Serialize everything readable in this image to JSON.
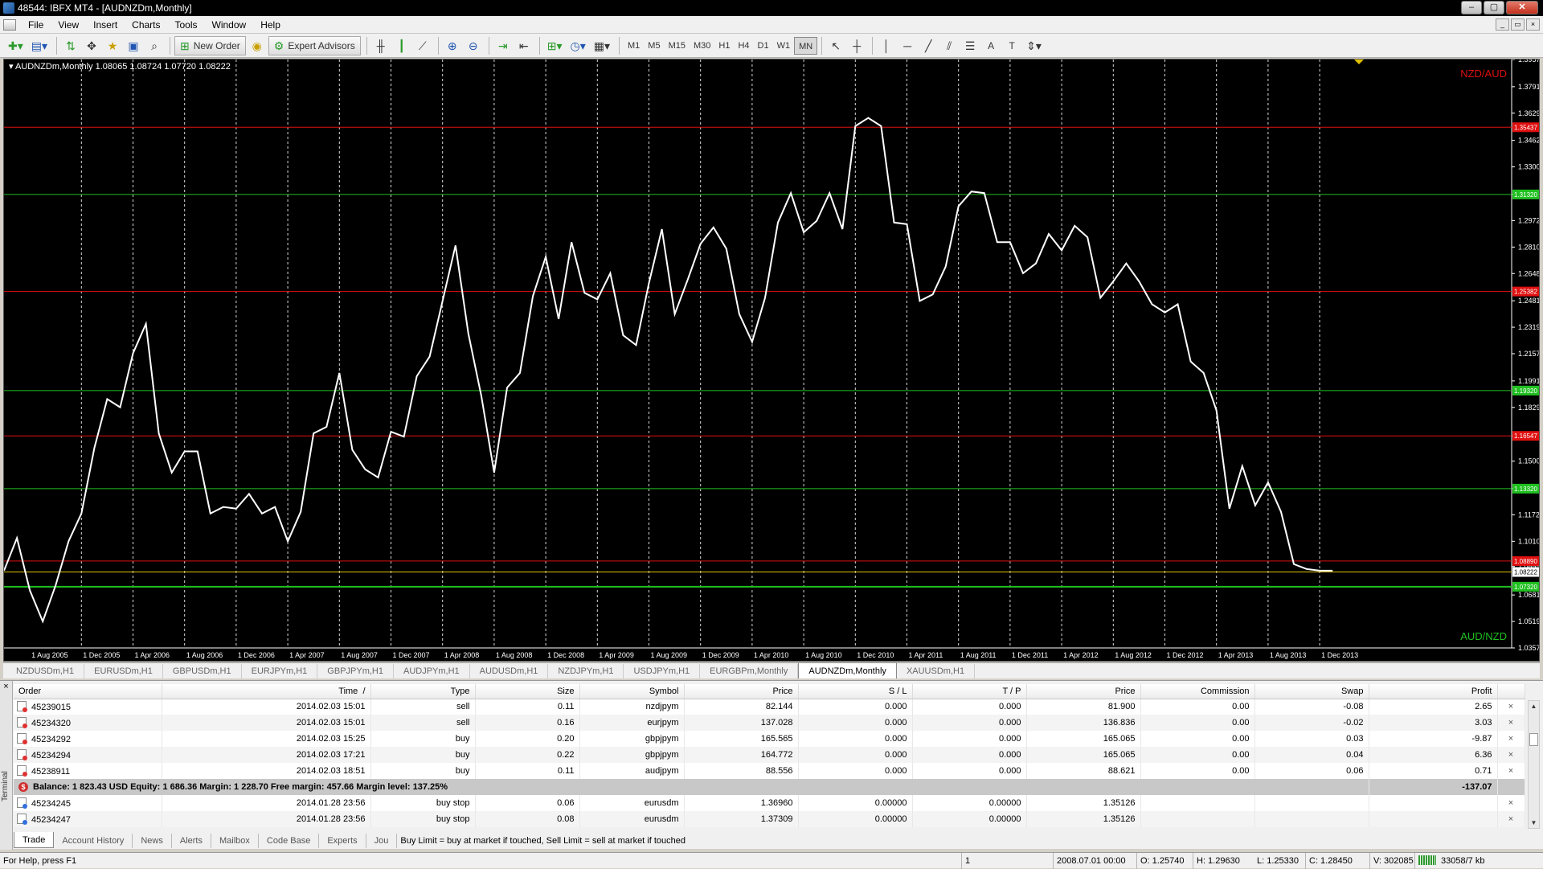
{
  "window": {
    "title": "48544: IBFX MT4 - [AUDNZDm,Monthly]",
    "buttons": [
      "–",
      "▢",
      "✕"
    ]
  },
  "menu": [
    "File",
    "View",
    "Insert",
    "Charts",
    "Tools",
    "Window",
    "Help"
  ],
  "mdi_buttons": [
    "_",
    "▭",
    "×"
  ],
  "toolbar": {
    "new_order": "New Order",
    "expert_advisors": "Expert Advisors",
    "timeframes": [
      "M1",
      "M5",
      "M15",
      "M30",
      "H1",
      "H4",
      "D1",
      "W1",
      "MN"
    ],
    "active_timeframe": "MN",
    "text_tool": "A",
    "label_tool": "T"
  },
  "chart": {
    "header": "AUDNZDm,Monthly  1.08065 1.08724 1.07720 1.08222",
    "pair_top_label": "NZD/AUD",
    "pair_bottom_label": "AUD/NZD",
    "current_price": "1.08222",
    "colors": {
      "background": "#000000",
      "line": "#ffffff",
      "red": "#e01010",
      "green": "#20c020",
      "yellow": "#e0c000"
    },
    "price_ticks": [
      "1.39575",
      "1.37910",
      "1.36290",
      "1.34625",
      "1.33005",
      "1.31320",
      "1.29720",
      "1.28100",
      "1.26480",
      "1.24815",
      "1.23195",
      "1.21575",
      "1.19910",
      "1.18290",
      "1.16547",
      "1.15005",
      "1.13320",
      "1.11720",
      "1.10100",
      "1.08555",
      "1.06815",
      "1.05195",
      "1.03575"
    ],
    "date_ticks": [
      "1 Aug 2005",
      "1 Dec 2005",
      "1 Apr 2006",
      "1 Aug 2006",
      "1 Dec 2006",
      "1 Apr 2007",
      "1 Aug 2007",
      "1 Dec 2007",
      "1 Apr 2008",
      "1 Aug 2008",
      "1 Dec 2008",
      "1 Apr 2009",
      "1 Aug 2009",
      "1 Dec 2009",
      "1 Apr 2010",
      "1 Aug 2010",
      "1 Dec 2010",
      "1 Apr 2011",
      "1 Aug 2011",
      "1 Dec 2011",
      "1 Apr 2012",
      "1 Aug 2012",
      "1 Dec 2012",
      "1 Apr 2013",
      "1 Aug 2013",
      "1 Dec 2013"
    ],
    "horizontal_lines": [
      {
        "price": 1.3543,
        "color": "red",
        "label": "1.35437"
      },
      {
        "price": 1.3132,
        "color": "green",
        "label": "1.31320"
      },
      {
        "price": 1.2538,
        "color": "red",
        "label": "1.25382"
      },
      {
        "price": 1.1932,
        "color": "green",
        "label": "1.19320"
      },
      {
        "price": 1.16547,
        "color": "red",
        "label": "1.16547"
      },
      {
        "price": 1.1332,
        "color": "green",
        "label": "1.13320"
      },
      {
        "price": 1.0889,
        "color": "red",
        "label": "1.08890"
      },
      {
        "price": 1.0732,
        "color": "green",
        "label": "1.07320"
      }
    ]
  },
  "chart_data": {
    "type": "line",
    "title": "AUDNZDm,Monthly",
    "xlabel": "",
    "ylabel": "",
    "ylim": [
      1.03575,
      1.39575
    ],
    "grid": "vertical dotted",
    "x_start": "2005-06",
    "x_step": "month",
    "close_values": [
      1.083,
      1.103,
      1.071,
      1.052,
      1.074,
      1.101,
      1.118,
      1.158,
      1.188,
      1.183,
      1.216,
      1.234,
      1.167,
      1.143,
      1.156,
      1.156,
      1.118,
      1.122,
      1.121,
      1.13,
      1.118,
      1.122,
      1.101,
      1.119,
      1.167,
      1.171,
      1.204,
      1.157,
      1.145,
      1.14,
      1.168,
      1.165,
      1.202,
      1.214,
      1.248,
      1.282,
      1.228,
      1.19,
      1.143,
      1.195,
      1.204,
      1.251,
      1.275,
      1.237,
      1.284,
      1.253,
      1.249,
      1.265,
      1.227,
      1.221,
      1.259,
      1.292,
      1.24,
      1.261,
      1.283,
      1.293,
      1.28,
      1.24,
      1.223,
      1.25,
      1.296,
      1.314,
      1.29,
      1.297,
      1.314,
      1.292,
      1.355,
      1.36,
      1.355,
      1.296,
      1.295,
      1.248,
      1.252,
      1.269,
      1.306,
      1.315,
      1.314,
      1.284,
      1.284,
      1.265,
      1.271,
      1.289,
      1.279,
      1.294,
      1.287,
      1.25,
      1.26,
      1.271,
      1.26,
      1.246,
      1.241,
      1.246,
      1.211,
      1.204,
      1.181,
      1.121,
      1.147,
      1.123,
      1.137,
      1.119,
      1.087,
      1.084,
      1.083,
      1.083
    ]
  },
  "symbol_tabs": [
    "NZDUSDm,H1",
    "EURUSDm,H1",
    "GBPUSDm,H1",
    "EURJPYm,H1",
    "GBPJPYm,H1",
    "AUDJPYm,H1",
    "AUDUSDm,H1",
    "NZDJPYm,H1",
    "USDJPYm,H1",
    "EURGBPm,Monthly",
    "AUDNZDm,Monthly",
    "XAUUSDm,H1"
  ],
  "active_symbol_tab": "AUDNZDm,Monthly",
  "terminal": {
    "side_label": "Terminal",
    "columns": [
      "Order",
      "Time",
      "Type",
      "Size",
      "Symbol",
      "Price",
      "S / L",
      "T / P",
      "Price",
      "Commission",
      "Swap",
      "Profit"
    ],
    "sort_indicator": "/",
    "rows": [
      {
        "order": "45239015",
        "time": "2014.02.03 15:01",
        "type": "sell",
        "size": "0.11",
        "symbol": "nzdjpym",
        "price": "82.144",
        "sl": "0.000",
        "tp": "0.000",
        "cur": "81.900",
        "commission": "0.00",
        "swap": "-0.08",
        "profit": "2.65"
      },
      {
        "order": "45234320",
        "time": "2014.02.03 15:01",
        "type": "sell",
        "size": "0.16",
        "symbol": "eurjpym",
        "price": "137.028",
        "sl": "0.000",
        "tp": "0.000",
        "cur": "136.836",
        "commission": "0.00",
        "swap": "-0.02",
        "profit": "3.03"
      },
      {
        "order": "45234292",
        "time": "2014.02.03 15:25",
        "type": "buy",
        "size": "0.20",
        "symbol": "gbpjpym",
        "price": "165.565",
        "sl": "0.000",
        "tp": "0.000",
        "cur": "165.065",
        "commission": "0.00",
        "swap": "0.03",
        "profit": "-9.87"
      },
      {
        "order": "45234294",
        "time": "2014.02.03 17:21",
        "type": "buy",
        "size": "0.22",
        "symbol": "gbpjpym",
        "price": "164.772",
        "sl": "0.000",
        "tp": "0.000",
        "cur": "165.065",
        "commission": "0.00",
        "swap": "0.04",
        "profit": "6.36"
      },
      {
        "order": "45238911",
        "time": "2014.02.03 18:51",
        "type": "buy",
        "size": "0.11",
        "symbol": "audjpym",
        "price": "88.556",
        "sl": "0.000",
        "tp": "0.000",
        "cur": "88.621",
        "commission": "0.00",
        "swap": "0.06",
        "profit": "0.71"
      }
    ],
    "balance_line": "Balance: 1 823.43 USD  Equity: 1 686.36  Margin: 1 228.70  Free margin: 457.66  Margin level: 137.25%",
    "balance_profit": "-137.07",
    "pending_rows": [
      {
        "order": "45234245",
        "time": "2014.01.28 23:56",
        "type": "buy stop",
        "size": "0.06",
        "symbol": "eurusdm",
        "price": "1.36960",
        "sl": "0.00000",
        "tp": "0.00000",
        "cur": "1.35126"
      },
      {
        "order": "45234247",
        "time": "2014.01.28 23:56",
        "type": "buy stop",
        "size": "0.08",
        "symbol": "eurusdm",
        "price": "1.37309",
        "sl": "0.00000",
        "tp": "0.00000",
        "cur": "1.35126"
      }
    ],
    "close_glyph": "×",
    "tabs": [
      "Trade",
      "Account History",
      "News",
      "Alerts",
      "Mailbox",
      "Code Base",
      "Experts",
      "Jou"
    ],
    "active_tab": "Trade",
    "hint": "Buy Limit = buy at market if touched, Sell Limit = sell at market if touched"
  },
  "status": {
    "help": "For Help, press F1",
    "profile": "1",
    "datetime": "2008.07.01 00:00",
    "open": "O: 1.25740",
    "high": "H: 1.29630",
    "low": "L: 1.25330",
    "close": "C: 1.28450",
    "volume": "V: 302085",
    "traffic": "33058/7 kb"
  }
}
